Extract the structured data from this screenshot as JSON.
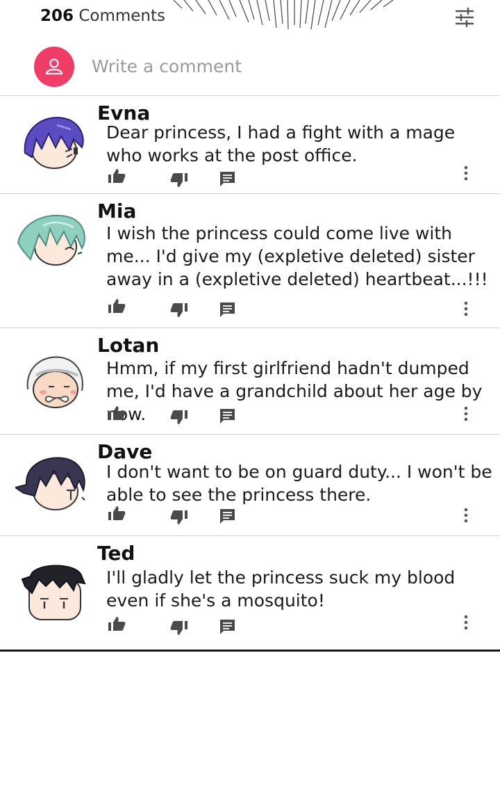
{
  "header": {
    "comment_count": "206",
    "comment_count_label": "Comments",
    "filter_icon": "sliders-icon"
  },
  "composer": {
    "avatar_icon": "user-icon",
    "placeholder": "Write a comment",
    "accent_color": "#ef3d67"
  },
  "comments": [
    {
      "author": "Evna",
      "text": "Dear princess, I had a fight with a mage who works at the post office.",
      "avatar": "purple-hair-avatar"
    },
    {
      "author": "Mia",
      "text": "I wish the princess could come live with me... I'd give my (expletive deleted) sister away in a (expletive deleted) heartbeat...!!!",
      "avatar": "green-hair-avatar"
    },
    {
      "author": "Lotan",
      "text": "Hmm, if my first girlfriend hadn't dumped me, I'd have a grandchild about her age by now.",
      "avatar": "old-man-avatar"
    },
    {
      "author": "Dave",
      "text": "I don't want to be on guard duty... I won't be able to see the princess there.",
      "avatar": "dark-hair-avatar"
    },
    {
      "author": "Ted",
      "text": "I'll gladly let the princess suck my blood even if she's a mosquito!",
      "avatar": "black-hair-avatar"
    }
  ],
  "action_icons": [
    "thumbs-up-icon",
    "thumbs-down-icon",
    "reply-icon",
    "more-vertical-icon"
  ]
}
